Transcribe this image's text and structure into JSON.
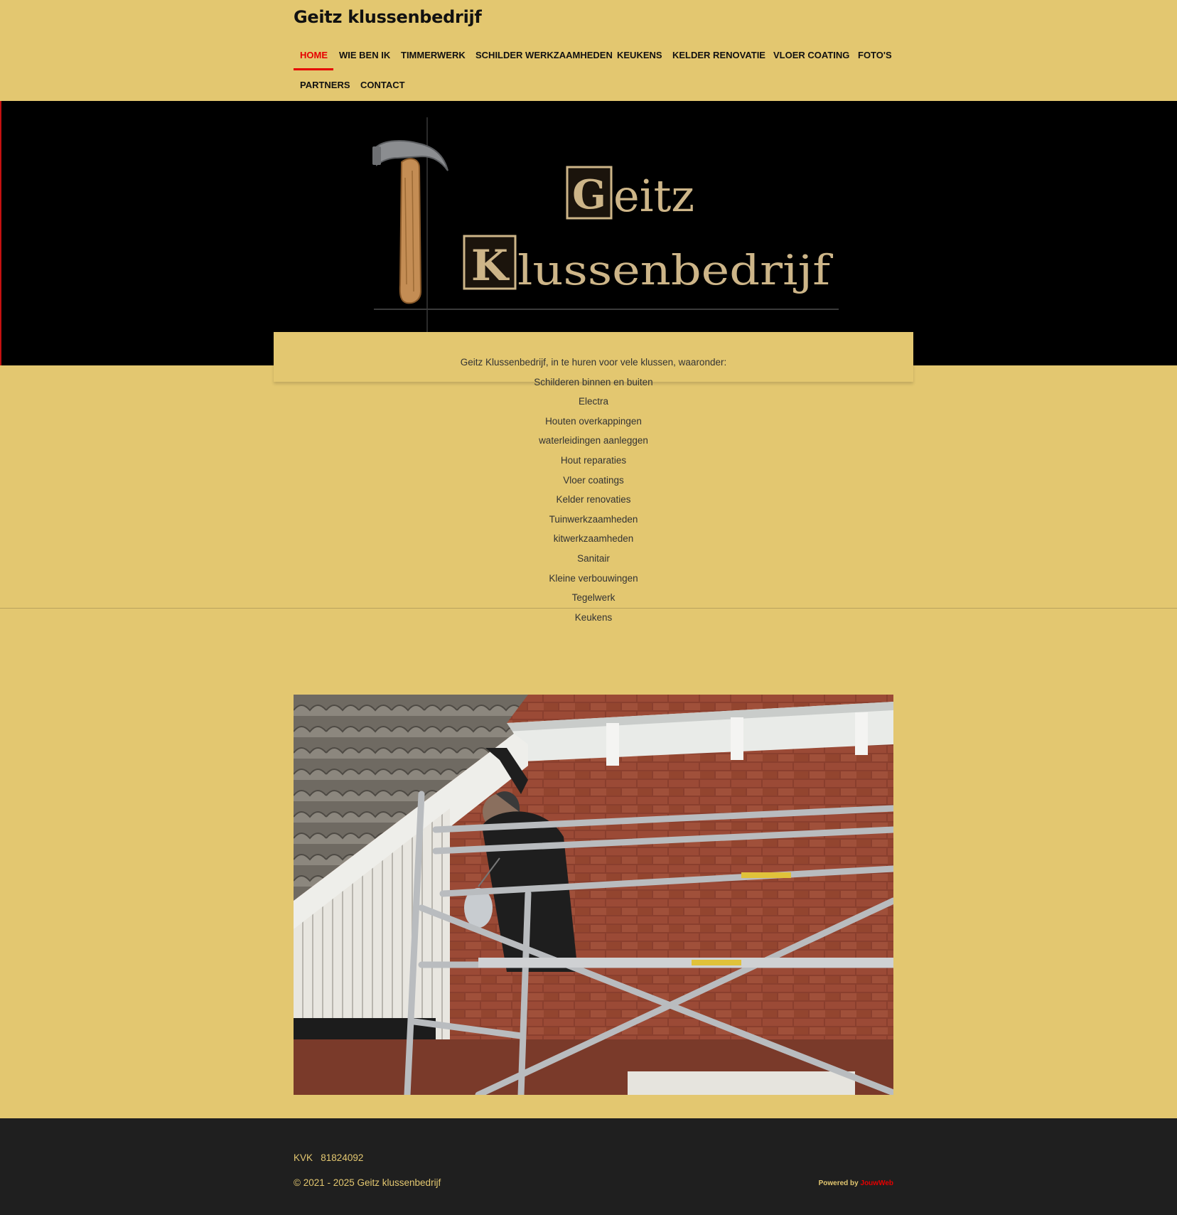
{
  "header": {
    "site_title": "Geitz klussenbedrijf",
    "nav": [
      {
        "label": "HOME",
        "active": true
      },
      {
        "label": "WIE BEN IK"
      },
      {
        "label": "TIMMERWERK"
      },
      {
        "label": "SCHILDER WERKZAAMHEDEN"
      },
      {
        "label": "KEUKENS"
      },
      {
        "label": "KELDER RENOVATIE"
      },
      {
        "label": "VLOER COATING"
      },
      {
        "label": "FOTO'S"
      },
      {
        "label": "PARTNERS"
      },
      {
        "label": "CONTACT"
      }
    ],
    "accent_color": "#e60000",
    "background_color": "#e3c770"
  },
  "hero": {
    "logo_line1": "Geitz",
    "logo_line2": "Klussenbedrijf",
    "logo_icon": "hammer-icon",
    "background_color": "#000000",
    "logo_text_color": "#cdb588"
  },
  "main": {
    "intro": "Geitz Klussenbedrijf, in te huren voor vele klussen, waaronder:",
    "services": [
      "Schilderen binnen en buiten",
      "Electra",
      "Houten overkappingen",
      "waterleidingen aanleggen",
      "Hout reparaties",
      "Vloer coatings",
      "Kelder renovaties",
      "Tuinwerkzaamheden",
      "kitwerkzaamheden",
      "Sanitair",
      "Kleine verbouwingen",
      "Tegelwerk",
      "Keukens"
    ],
    "photo": "worker-on-scaffolding-photo"
  },
  "footer": {
    "kvk_label": "KVK",
    "kvk_number": "81824092",
    "copyright": "© 2021 - 2025 Geitz klussenbedrijf",
    "powered_label": "Powered by",
    "powered_brand": "JouwWeb",
    "background_color": "#1f1f1f"
  }
}
